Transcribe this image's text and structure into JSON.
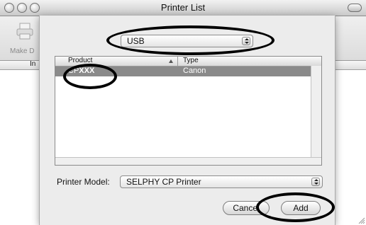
{
  "window": {
    "title": "Printer List",
    "toolbar_label": "Make D",
    "column_partial": "In"
  },
  "sheet": {
    "connection_popup": {
      "value": "USB"
    },
    "table": {
      "columns": [
        "Product",
        "Type"
      ],
      "rows": [
        {
          "product_prefix": "CP",
          "product_model": "XXX",
          "type": "Canon",
          "selected": true
        }
      ]
    },
    "printer_model": {
      "label": "Printer Model:",
      "value": "SELPHY CP Printer"
    },
    "buttons": {
      "cancel": "Cancel",
      "add": "Add"
    }
  },
  "annotation": {
    "color": "#000000"
  }
}
